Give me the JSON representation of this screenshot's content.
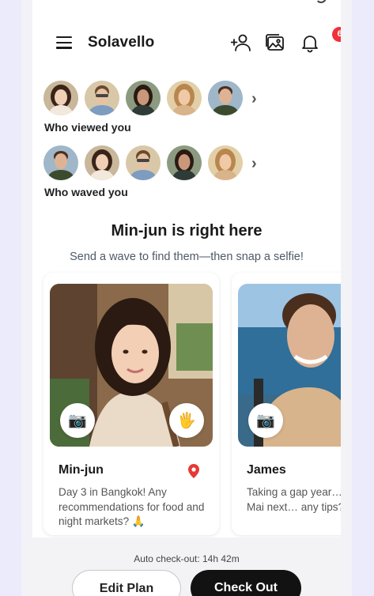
{
  "app": {
    "brand": "Solavello"
  },
  "header": {
    "notification_count": "6",
    "icons": [
      "menu-icon",
      "add-user-icon",
      "gallery-icon",
      "bell-icon"
    ]
  },
  "viewed": {
    "label": "Who viewed you"
  },
  "waved": {
    "label": "Who waved you"
  },
  "section": {
    "title": "Min-jun is right here",
    "subtitle": "Send a wave to find them—then snap a selfie!"
  },
  "cards": [
    {
      "name": "Min-jun",
      "message": "Day 3 in Bangkok! Any recommendations for food and night markets? 🙏",
      "icons": [
        "camera-icon",
        "wave-hand-icon",
        "location-pin-icon"
      ]
    },
    {
      "name": "James",
      "message": "Taking a gap year… to Chiang Mai next… any tips?",
      "icons": [
        "camera-icon"
      ]
    }
  ],
  "footer": {
    "auto_checkout": "Auto check-out: 14h 42m",
    "edit_plan": "Edit Plan",
    "check_out": "Check Out"
  },
  "colors": {
    "accent": "#121212",
    "badge": "#f0303a",
    "pin": "#e53935"
  }
}
